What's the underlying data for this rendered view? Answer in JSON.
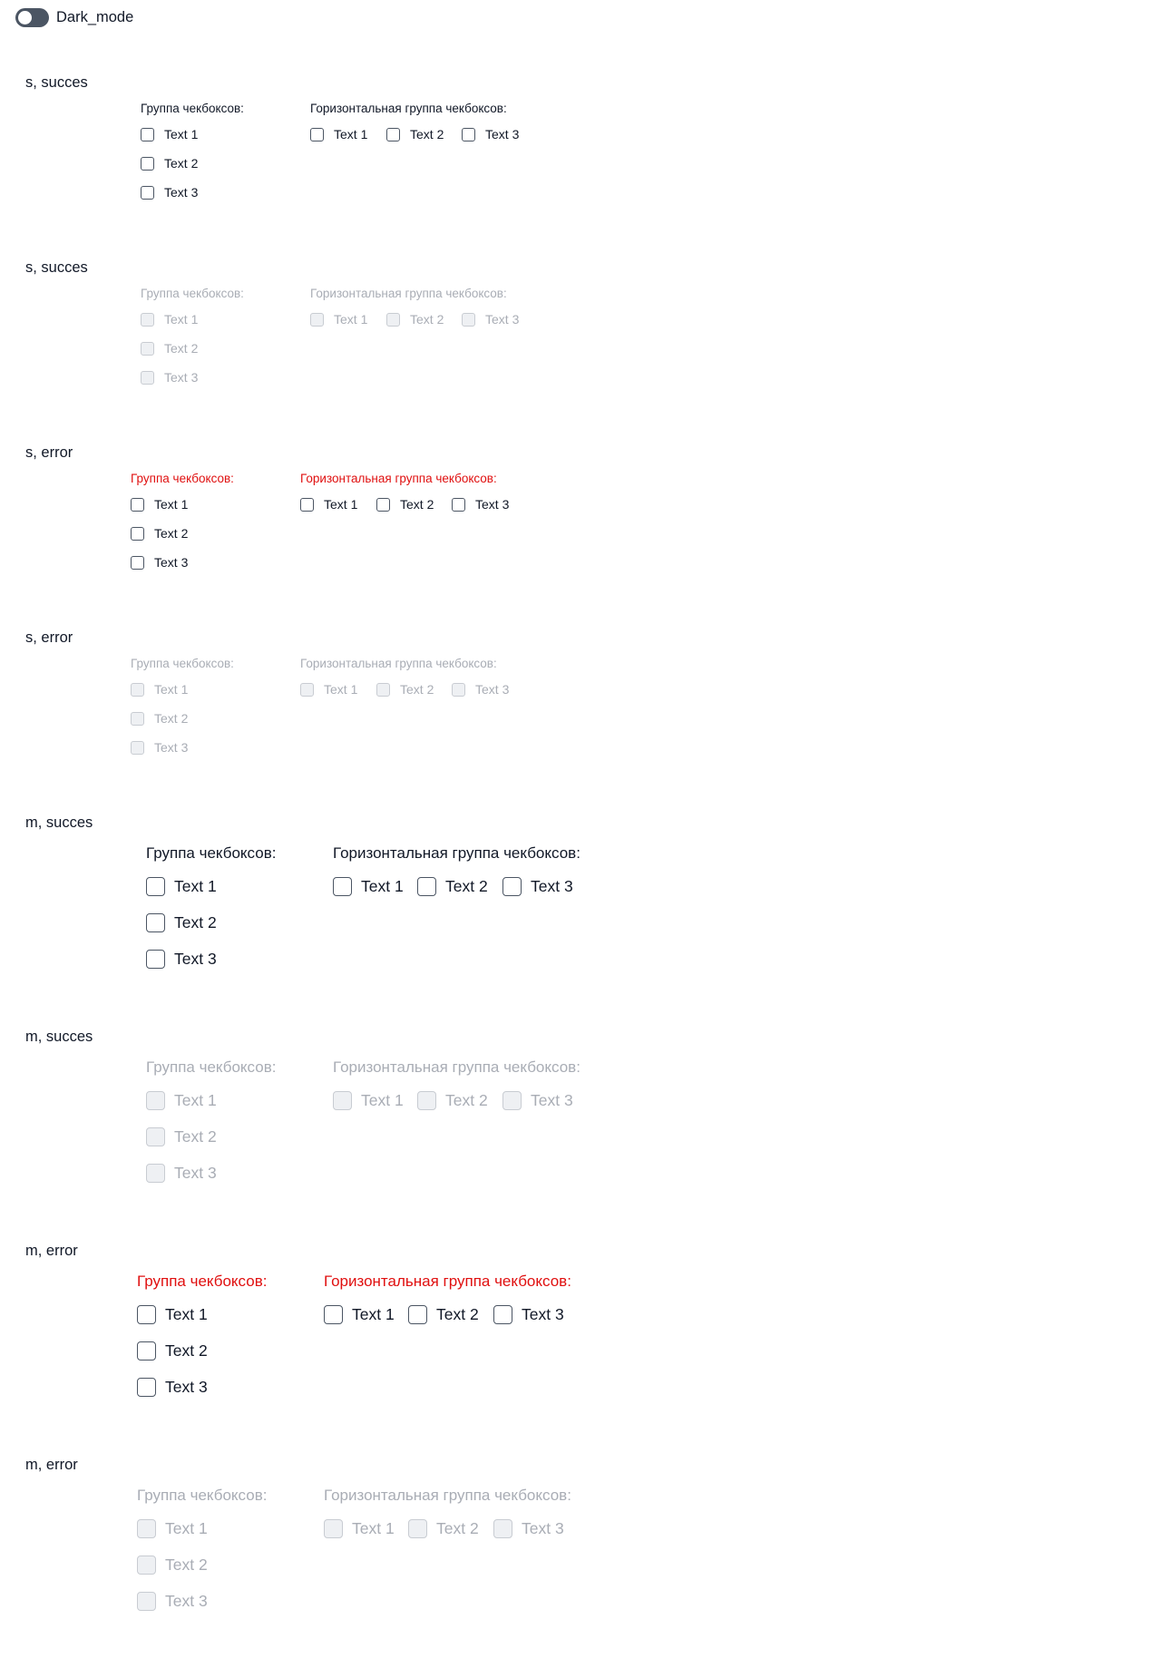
{
  "dark_mode": {
    "label": "Dark_mode",
    "enabled": false
  },
  "group_label": "Группа чекбоксов:",
  "horizontal_group_label": "Горизонтальная группа чекбоксов:",
  "options": [
    "Text 1",
    "Text 2",
    "Text 3"
  ],
  "sections": [
    {
      "title": "s, succes",
      "size": "s",
      "state": "success",
      "disabled": false
    },
    {
      "title": "s, succes",
      "size": "s",
      "state": "success",
      "disabled": true
    },
    {
      "title": "s, error",
      "size": "s",
      "state": "error",
      "disabled": false
    },
    {
      "title": "s, error",
      "size": "s",
      "state": "error",
      "disabled": true
    },
    {
      "title": "m, succes",
      "size": "m",
      "state": "success",
      "disabled": false
    },
    {
      "title": "m, succes",
      "size": "m",
      "state": "success",
      "disabled": true
    },
    {
      "title": "m, error",
      "size": "m",
      "state": "error",
      "disabled": false
    },
    {
      "title": "m, error",
      "size": "m",
      "state": "error",
      "disabled": true
    }
  ],
  "colors": {
    "text": "#111827",
    "error": "#e01010",
    "disabled": "#a9adb5",
    "toggle_track": "#4b5563"
  }
}
